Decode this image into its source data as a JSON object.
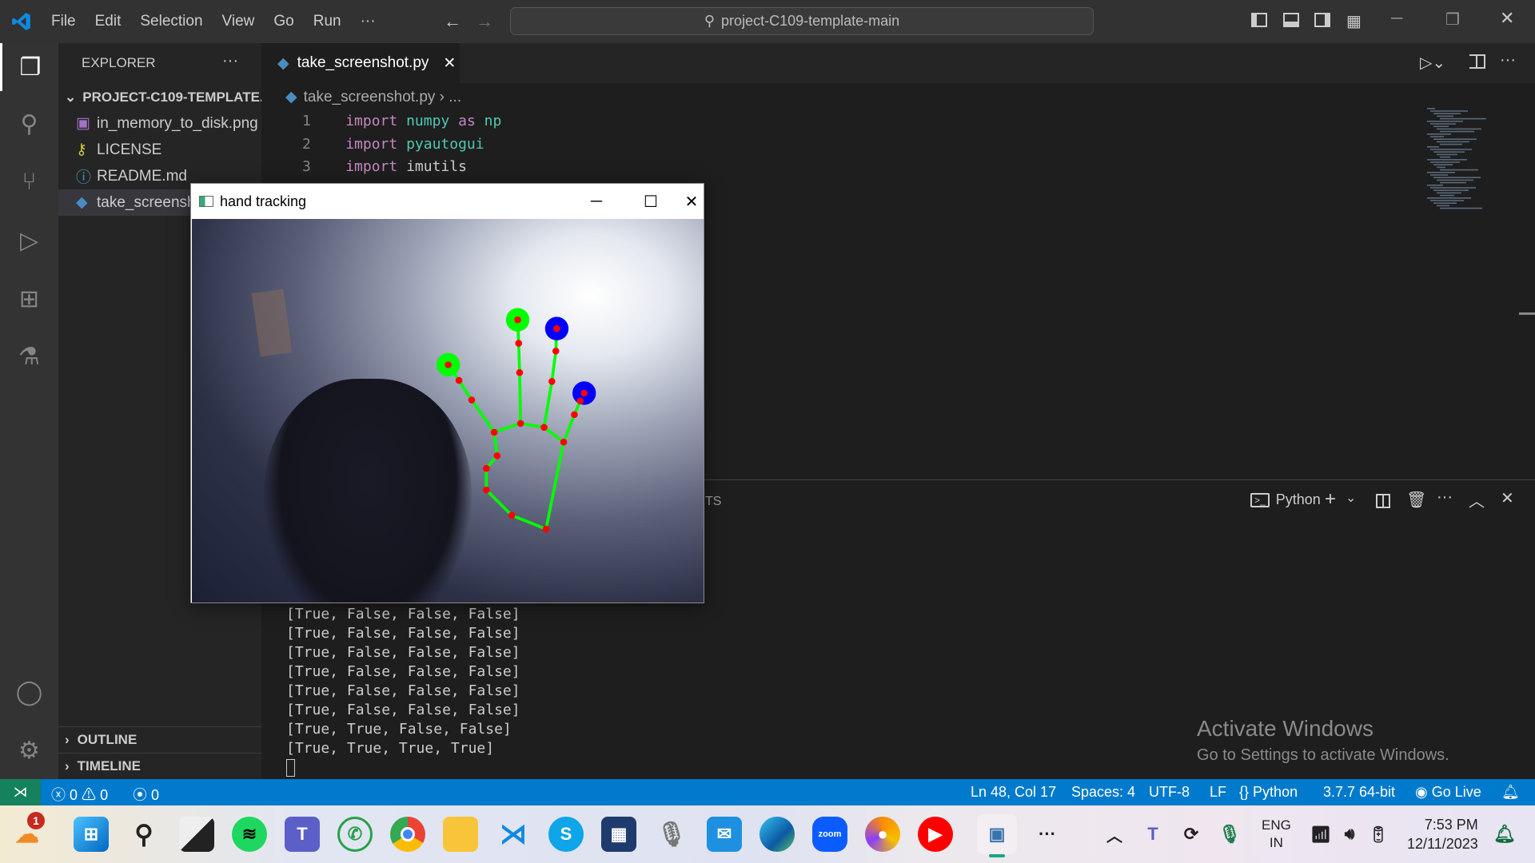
{
  "titlebar": {
    "menus": [
      "File",
      "Edit",
      "Selection",
      "View",
      "Go",
      "Run",
      "···"
    ],
    "search": "project-C109-template-main"
  },
  "sidebar": {
    "title": "EXPLORER",
    "more": "···",
    "folder": "PROJECT-C109-TEMPLATE...",
    "files": [
      {
        "name": "in_memory_to_disk.png",
        "icon": "image-icon"
      },
      {
        "name": "LICENSE",
        "icon": "license-icon"
      },
      {
        "name": "README.md",
        "icon": "info-icon"
      },
      {
        "name": "take_screenshot.py",
        "icon": "python-icon"
      }
    ],
    "outline": "OUTLINE",
    "timeline": "TIMELINE"
  },
  "editor": {
    "tab": "take_screenshot.py",
    "breadcrumb": "take_screenshot.py",
    "breadcrumb_more": "...",
    "lines": [
      {
        "n": "1",
        "kw": "import",
        "mod": "numpy",
        "as": "as",
        "alias": "np"
      },
      {
        "n": "2",
        "kw": "import",
        "mod": "pyautogui"
      },
      {
        "n": "3",
        "kw": "import",
        "id": "imutils"
      }
    ]
  },
  "panel": {
    "tab_fragment": "TS",
    "terminal_name": "Python",
    "output": [
      "[True, False, False, False]",
      "[True, False, False, False]",
      "[True, False, False, False]",
      "[True, False, False, False]",
      "[True, False, False, False]",
      "[True, False, False, False]",
      "[True, True, False, False]",
      "[True, True, True, True]"
    ]
  },
  "hand_window": {
    "title": "hand tracking",
    "colors": {
      "landmark": "#ff0000",
      "connection": "#00ff00",
      "fingertip_up": "#00ff00",
      "fingertip_down": "#0000ff"
    }
  },
  "watermark": {
    "title": "Activate Windows",
    "subtitle": "Go to Settings to activate Windows."
  },
  "statusbar": {
    "errors": "0",
    "warnings": "0",
    "ports": "0",
    "position": "Ln 48, Col 17",
    "spaces": "Spaces: 4",
    "encoding": "UTF-8",
    "eol": "LF",
    "language": "Python",
    "interpreter": "3.7.7 64-bit",
    "golive": "Go Live"
  },
  "taskbar": {
    "weather_badge": "1",
    "lang1": "ENG",
    "lang2": "IN",
    "time": "7:53 PM",
    "date": "12/11/2023",
    "zoom": "zoom"
  },
  "colors": {
    "statusbar": "#007acc",
    "remote": "#16825d"
  }
}
